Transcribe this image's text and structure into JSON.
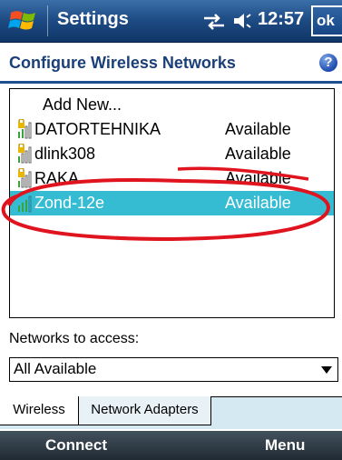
{
  "titlebar": {
    "app_title": "Settings",
    "time": "12:57",
    "ok_label": "ok"
  },
  "header": {
    "title": "Configure Wireless Networks",
    "help_label": "?"
  },
  "network_list": {
    "add_new_label": "Add New...",
    "items": [
      {
        "name": "DATORTEHNIKA",
        "status": "Available",
        "icon": "secured-wifi-signal-icon"
      },
      {
        "name": "dlink308",
        "status": "Available",
        "icon": "secured-wifi-signal-icon"
      },
      {
        "name": "RAKA",
        "status": "Available",
        "icon": "secured-wifi-signal-icon"
      },
      {
        "name": "Zond-12e",
        "status": "Available",
        "icon": "wifi-signal-icon",
        "selected": true
      }
    ]
  },
  "filter": {
    "label": "Networks to access:",
    "selected_value": "All Available"
  },
  "tabs": [
    {
      "label": "Wireless",
      "active": true
    },
    {
      "label": "Network Adapters",
      "active": false
    }
  ],
  "softkeys": {
    "left": "Connect",
    "right": "Menu"
  },
  "colors": {
    "title_bar": "#1f4d86",
    "header_text": "#1b3f78",
    "selection": "#35bcd3",
    "annotation": "#e0141e",
    "tab_strip": "#d4e9f1",
    "softkey_bar": "#2c3842"
  }
}
